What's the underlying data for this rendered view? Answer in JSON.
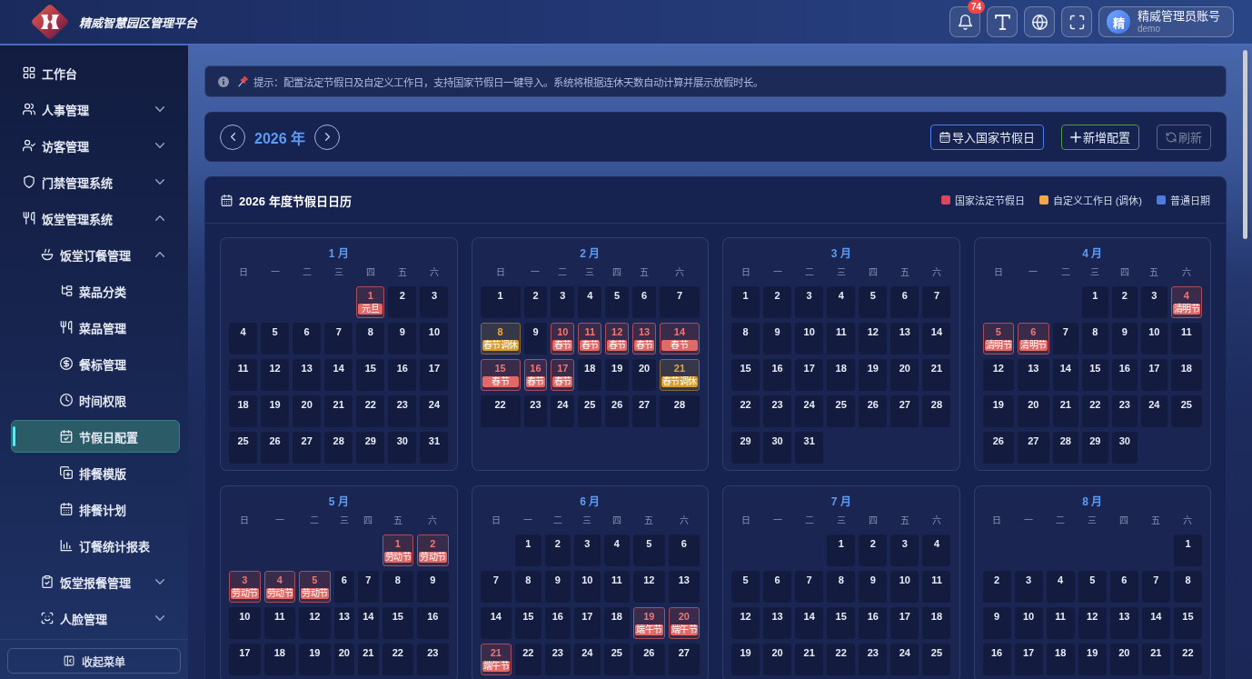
{
  "header": {
    "title": "精威智慧园区管理平台",
    "tools": [
      {
        "kind": "notifications",
        "badge": "74"
      },
      {
        "kind": "font-size"
      },
      {
        "kind": "language"
      },
      {
        "kind": "fullscreen"
      }
    ],
    "user": {
      "avatar": "精",
      "name": "精威管理员账号",
      "account": "demo"
    }
  },
  "sidebar": {
    "items": [
      {
        "label": "工作台",
        "kind": "page",
        "selected": false
      },
      {
        "label": "人事管理",
        "kind": "group",
        "expanded": false,
        "selected": false
      },
      {
        "label": "访客管理",
        "kind": "group",
        "expanded": false,
        "selected": false
      },
      {
        "label": "门禁管理系统",
        "kind": "group",
        "expanded": false,
        "selected": false
      },
      {
        "label": "饭堂管理系统",
        "kind": "group",
        "expanded": true,
        "selected": false,
        "children": [
          {
            "label": "饭堂订餐管理",
            "kind": "group",
            "expanded": true,
            "selected": false,
            "children": [
              {
                "label": "菜品分类",
                "kind": "page",
                "selected": false
              },
              {
                "label": "菜品管理",
                "kind": "page",
                "selected": false
              },
              {
                "label": "餐标管理",
                "kind": "page",
                "selected": false
              },
              {
                "label": "时间权限",
                "kind": "page",
                "selected": false
              },
              {
                "label": "节假日配置",
                "kind": "page",
                "selected": true
              },
              {
                "label": "排餐模版",
                "kind": "page",
                "selected": false
              },
              {
                "label": "排餐计划",
                "kind": "page",
                "selected": false
              },
              {
                "label": "订餐统计报表",
                "kind": "page",
                "selected": false
              }
            ]
          },
          {
            "label": "饭堂报餐管理",
            "kind": "group",
            "expanded": false,
            "selected": false
          },
          {
            "label": "人脸管理",
            "kind": "group",
            "expanded": false,
            "selected": false
          }
        ]
      }
    ],
    "collapse_button": {
      "label": "收起菜单"
    }
  },
  "notice": {
    "text": "提示：配置法定节假日及自定义工作日，支持国家节假日一键导入。系统将根据连休天数自动计算并展示放假时长。"
  },
  "year_bar": {
    "year": "2026 年",
    "buttons": [
      {
        "label": "导入国家节假日",
        "kind": "import",
        "disabled": false
      },
      {
        "label": "新增配置",
        "kind": "add",
        "disabled": false
      },
      {
        "label": "刷新",
        "kind": "refresh",
        "disabled": true
      }
    ]
  },
  "calendar": {
    "title": "2026 年度节假日日历",
    "legend": [
      {
        "label": "国家法定节假日",
        "color": "#dc465c"
      },
      {
        "label": "自定义工作日 (调休)",
        "color": "#f2a64a"
      },
      {
        "label": "普通日期",
        "color": "#4f7be0"
      }
    ],
    "months": [
      {
        "title": "1 月",
        "weekdays": [
          "日",
          "一",
          "二",
          "三",
          "四",
          "五",
          "六"
        ],
        "days": [
          {
            "kind": "empty"
          },
          {
            "kind": "empty"
          },
          {
            "kind": "empty"
          },
          {
            "kind": "empty"
          },
          {
            "day": "1",
            "kind": "holiday",
            "label": "元旦"
          },
          {
            "day": "2",
            "kind": "normal"
          },
          {
            "day": "3",
            "kind": "normal"
          },
          {
            "day": "4",
            "kind": "normal"
          },
          {
            "day": "5",
            "kind": "normal"
          },
          {
            "day": "6",
            "kind": "normal"
          },
          {
            "day": "7",
            "kind": "normal"
          },
          {
            "day": "8",
            "kind": "normal"
          },
          {
            "day": "9",
            "kind": "normal"
          },
          {
            "day": "10",
            "kind": "normal"
          },
          {
            "day": "11",
            "kind": "normal"
          },
          {
            "day": "12",
            "kind": "normal"
          },
          {
            "day": "13",
            "kind": "normal"
          },
          {
            "day": "14",
            "kind": "normal"
          },
          {
            "day": "15",
            "kind": "normal"
          },
          {
            "day": "16",
            "kind": "normal"
          },
          {
            "day": "17",
            "kind": "normal"
          },
          {
            "day": "18",
            "kind": "normal"
          },
          {
            "day": "19",
            "kind": "normal"
          },
          {
            "day": "20",
            "kind": "normal"
          },
          {
            "day": "21",
            "kind": "normal"
          },
          {
            "day": "22",
            "kind": "normal"
          },
          {
            "day": "23",
            "kind": "normal"
          },
          {
            "day": "24",
            "kind": "normal"
          },
          {
            "day": "25",
            "kind": "normal"
          },
          {
            "day": "26",
            "kind": "normal"
          },
          {
            "day": "27",
            "kind": "normal"
          },
          {
            "day": "28",
            "kind": "normal"
          },
          {
            "day": "29",
            "kind": "normal"
          },
          {
            "day": "30",
            "kind": "normal"
          },
          {
            "day": "31",
            "kind": "normal"
          }
        ]
      },
      {
        "title": "2 月",
        "weekdays": [
          "日",
          "一",
          "二",
          "三",
          "四",
          "五",
          "六"
        ],
        "days": [
          {
            "day": "1",
            "kind": "normal"
          },
          {
            "day": "2",
            "kind": "normal"
          },
          {
            "day": "3",
            "kind": "normal"
          },
          {
            "day": "4",
            "kind": "normal"
          },
          {
            "day": "5",
            "kind": "normal"
          },
          {
            "day": "6",
            "kind": "normal"
          },
          {
            "day": "7",
            "kind": "normal"
          },
          {
            "day": "8",
            "kind": "workday",
            "label": "春节调休"
          },
          {
            "day": "9",
            "kind": "normal"
          },
          {
            "day": "10",
            "kind": "holiday",
            "label": "春节"
          },
          {
            "day": "11",
            "kind": "holiday",
            "label": "春节"
          },
          {
            "day": "12",
            "kind": "holiday",
            "label": "春节"
          },
          {
            "day": "13",
            "kind": "holiday",
            "label": "春节"
          },
          {
            "day": "14",
            "kind": "holiday",
            "label": "春节"
          },
          {
            "day": "15",
            "kind": "holiday",
            "label": "春节"
          },
          {
            "day": "16",
            "kind": "holiday",
            "label": "春节"
          },
          {
            "day": "17",
            "kind": "holiday",
            "label": "春节"
          },
          {
            "day": "18",
            "kind": "normal"
          },
          {
            "day": "19",
            "kind": "normal"
          },
          {
            "day": "20",
            "kind": "normal"
          },
          {
            "day": "21",
            "kind": "workday",
            "label": "春节调休"
          },
          {
            "day": "22",
            "kind": "normal"
          },
          {
            "day": "23",
            "kind": "normal"
          },
          {
            "day": "24",
            "kind": "normal"
          },
          {
            "day": "25",
            "kind": "normal"
          },
          {
            "day": "26",
            "kind": "normal"
          },
          {
            "day": "27",
            "kind": "normal"
          },
          {
            "day": "28",
            "kind": "normal"
          }
        ]
      },
      {
        "title": "3 月",
        "weekdays": [
          "日",
          "一",
          "二",
          "三",
          "四",
          "五",
          "六"
        ],
        "days": [
          {
            "day": "1",
            "kind": "normal"
          },
          {
            "day": "2",
            "kind": "normal"
          },
          {
            "day": "3",
            "kind": "normal"
          },
          {
            "day": "4",
            "kind": "normal"
          },
          {
            "day": "5",
            "kind": "normal"
          },
          {
            "day": "6",
            "kind": "normal"
          },
          {
            "day": "7",
            "kind": "normal"
          },
          {
            "day": "8",
            "kind": "normal"
          },
          {
            "day": "9",
            "kind": "normal"
          },
          {
            "day": "10",
            "kind": "normal"
          },
          {
            "day": "11",
            "kind": "normal"
          },
          {
            "day": "12",
            "kind": "normal"
          },
          {
            "day": "13",
            "kind": "normal"
          },
          {
            "day": "14",
            "kind": "normal"
          },
          {
            "day": "15",
            "kind": "normal"
          },
          {
            "day": "16",
            "kind": "normal"
          },
          {
            "day": "17",
            "kind": "normal"
          },
          {
            "day": "18",
            "kind": "normal"
          },
          {
            "day": "19",
            "kind": "normal"
          },
          {
            "day": "20",
            "kind": "normal"
          },
          {
            "day": "21",
            "kind": "normal"
          },
          {
            "day": "22",
            "kind": "normal"
          },
          {
            "day": "23",
            "kind": "normal"
          },
          {
            "day": "24",
            "kind": "normal"
          },
          {
            "day": "25",
            "kind": "normal"
          },
          {
            "day": "26",
            "kind": "normal"
          },
          {
            "day": "27",
            "kind": "normal"
          },
          {
            "day": "28",
            "kind": "normal"
          },
          {
            "day": "29",
            "kind": "normal"
          },
          {
            "day": "30",
            "kind": "normal"
          },
          {
            "day": "31",
            "kind": "normal"
          }
        ]
      },
      {
        "title": "4 月",
        "weekdays": [
          "日",
          "一",
          "二",
          "三",
          "四",
          "五",
          "六"
        ],
        "days": [
          {
            "kind": "empty"
          },
          {
            "kind": "empty"
          },
          {
            "kind": "empty"
          },
          {
            "day": "1",
            "kind": "normal"
          },
          {
            "day": "2",
            "kind": "normal"
          },
          {
            "day": "3",
            "kind": "normal"
          },
          {
            "day": "4",
            "kind": "holiday",
            "label": "清明节"
          },
          {
            "day": "5",
            "kind": "holiday",
            "label": "清明节"
          },
          {
            "day": "6",
            "kind": "holiday",
            "label": "清明节"
          },
          {
            "day": "7",
            "kind": "normal"
          },
          {
            "day": "8",
            "kind": "normal"
          },
          {
            "day": "9",
            "kind": "normal"
          },
          {
            "day": "10",
            "kind": "normal"
          },
          {
            "day": "11",
            "kind": "normal"
          },
          {
            "day": "12",
            "kind": "normal"
          },
          {
            "day": "13",
            "kind": "normal"
          },
          {
            "day": "14",
            "kind": "normal"
          },
          {
            "day": "15",
            "kind": "normal"
          },
          {
            "day": "16",
            "kind": "normal"
          },
          {
            "day": "17",
            "kind": "normal"
          },
          {
            "day": "18",
            "kind": "normal"
          },
          {
            "day": "19",
            "kind": "normal"
          },
          {
            "day": "20",
            "kind": "normal"
          },
          {
            "day": "21",
            "kind": "normal"
          },
          {
            "day": "22",
            "kind": "normal"
          },
          {
            "day": "23",
            "kind": "normal"
          },
          {
            "day": "24",
            "kind": "normal"
          },
          {
            "day": "25",
            "kind": "normal"
          },
          {
            "day": "26",
            "kind": "normal"
          },
          {
            "day": "27",
            "kind": "normal"
          },
          {
            "day": "28",
            "kind": "normal"
          },
          {
            "day": "29",
            "kind": "normal"
          },
          {
            "day": "30",
            "kind": "normal"
          }
        ]
      },
      {
        "title": "5 月",
        "weekdays": [
          "日",
          "一",
          "二",
          "三",
          "四",
          "五",
          "六"
        ],
        "days": [
          {
            "kind": "empty"
          },
          {
            "kind": "empty"
          },
          {
            "kind": "empty"
          },
          {
            "kind": "empty"
          },
          {
            "kind": "empty"
          },
          {
            "day": "1",
            "kind": "holiday",
            "label": "劳动节"
          },
          {
            "day": "2",
            "kind": "holiday",
            "label": "劳动节"
          },
          {
            "day": "3",
            "kind": "holiday",
            "label": "劳动节"
          },
          {
            "day": "4",
            "kind": "holiday",
            "label": "劳动节"
          },
          {
            "day": "5",
            "kind": "holiday",
            "label": "劳动节"
          },
          {
            "day": "6",
            "kind": "normal"
          },
          {
            "day": "7",
            "kind": "normal"
          },
          {
            "day": "8",
            "kind": "normal"
          },
          {
            "day": "9",
            "kind": "normal"
          },
          {
            "day": "10",
            "kind": "normal"
          },
          {
            "day": "11",
            "kind": "normal"
          },
          {
            "day": "12",
            "kind": "normal"
          },
          {
            "day": "13",
            "kind": "normal"
          },
          {
            "day": "14",
            "kind": "normal"
          },
          {
            "day": "15",
            "kind": "normal"
          },
          {
            "day": "16",
            "kind": "normal"
          },
          {
            "day": "17",
            "kind": "normal"
          },
          {
            "day": "18",
            "kind": "normal"
          },
          {
            "day": "19",
            "kind": "normal"
          },
          {
            "day": "20",
            "kind": "normal"
          },
          {
            "day": "21",
            "kind": "normal"
          },
          {
            "day": "22",
            "kind": "normal"
          },
          {
            "day": "23",
            "kind": "normal"
          }
        ]
      },
      {
        "title": "6 月",
        "weekdays": [
          "日",
          "一",
          "二",
          "三",
          "四",
          "五",
          "六"
        ],
        "days": [
          {
            "kind": "empty"
          },
          {
            "day": "1",
            "kind": "normal"
          },
          {
            "day": "2",
            "kind": "normal"
          },
          {
            "day": "3",
            "kind": "normal"
          },
          {
            "day": "4",
            "kind": "normal"
          },
          {
            "day": "5",
            "kind": "normal"
          },
          {
            "day": "6",
            "kind": "normal"
          },
          {
            "day": "7",
            "kind": "normal"
          },
          {
            "day": "8",
            "kind": "normal"
          },
          {
            "day": "9",
            "kind": "normal"
          },
          {
            "day": "10",
            "kind": "normal"
          },
          {
            "day": "11",
            "kind": "normal"
          },
          {
            "day": "12",
            "kind": "normal"
          },
          {
            "day": "13",
            "kind": "normal"
          },
          {
            "day": "14",
            "kind": "normal"
          },
          {
            "day": "15",
            "kind": "normal"
          },
          {
            "day": "16",
            "kind": "normal"
          },
          {
            "day": "17",
            "kind": "normal"
          },
          {
            "day": "18",
            "kind": "normal"
          },
          {
            "day": "19",
            "kind": "holiday",
            "label": "端午节"
          },
          {
            "day": "20",
            "kind": "holiday",
            "label": "端午节"
          },
          {
            "day": "21",
            "kind": "holiday",
            "label": "端午节"
          },
          {
            "day": "22",
            "kind": "normal"
          },
          {
            "day": "23",
            "kind": "normal"
          },
          {
            "day": "24",
            "kind": "normal"
          },
          {
            "day": "25",
            "kind": "normal"
          },
          {
            "day": "26",
            "kind": "normal"
          },
          {
            "day": "27",
            "kind": "normal"
          }
        ]
      },
      {
        "title": "7 月",
        "weekdays": [
          "日",
          "一",
          "二",
          "三",
          "四",
          "五",
          "六"
        ],
        "days": [
          {
            "kind": "empty"
          },
          {
            "kind": "empty"
          },
          {
            "kind": "empty"
          },
          {
            "day": "1",
            "kind": "normal"
          },
          {
            "day": "2",
            "kind": "normal"
          },
          {
            "day": "3",
            "kind": "normal"
          },
          {
            "day": "4",
            "kind": "normal"
          },
          {
            "day": "5",
            "kind": "normal"
          },
          {
            "day": "6",
            "kind": "normal"
          },
          {
            "day": "7",
            "kind": "normal"
          },
          {
            "day": "8",
            "kind": "normal"
          },
          {
            "day": "9",
            "kind": "normal"
          },
          {
            "day": "10",
            "kind": "normal"
          },
          {
            "day": "11",
            "kind": "normal"
          },
          {
            "day": "12",
            "kind": "normal"
          },
          {
            "day": "13",
            "kind": "normal"
          },
          {
            "day": "14",
            "kind": "normal"
          },
          {
            "day": "15",
            "kind": "normal"
          },
          {
            "day": "16",
            "kind": "normal"
          },
          {
            "day": "17",
            "kind": "normal"
          },
          {
            "day": "18",
            "kind": "normal"
          },
          {
            "day": "19",
            "kind": "normal"
          },
          {
            "day": "20",
            "kind": "normal"
          },
          {
            "day": "21",
            "kind": "normal"
          },
          {
            "day": "22",
            "kind": "normal"
          },
          {
            "day": "23",
            "kind": "normal"
          },
          {
            "day": "24",
            "kind": "normal"
          },
          {
            "day": "25",
            "kind": "normal"
          }
        ]
      },
      {
        "title": "8 月",
        "weekdays": [
          "日",
          "一",
          "二",
          "三",
          "四",
          "五",
          "六"
        ],
        "days": [
          {
            "kind": "empty"
          },
          {
            "kind": "empty"
          },
          {
            "kind": "empty"
          },
          {
            "kind": "empty"
          },
          {
            "kind": "empty"
          },
          {
            "kind": "empty"
          },
          {
            "day": "1",
            "kind": "normal"
          },
          {
            "day": "2",
            "kind": "normal"
          },
          {
            "day": "3",
            "kind": "normal"
          },
          {
            "day": "4",
            "kind": "normal"
          },
          {
            "day": "5",
            "kind": "normal"
          },
          {
            "day": "6",
            "kind": "normal"
          },
          {
            "day": "7",
            "kind": "normal"
          },
          {
            "day": "8",
            "kind": "normal"
          },
          {
            "day": "9",
            "kind": "normal"
          },
          {
            "day": "10",
            "kind": "normal"
          },
          {
            "day": "11",
            "kind": "normal"
          },
          {
            "day": "12",
            "kind": "normal"
          },
          {
            "day": "13",
            "kind": "normal"
          },
          {
            "day": "14",
            "kind": "normal"
          },
          {
            "day": "15",
            "kind": "normal"
          },
          {
            "day": "16",
            "kind": "normal"
          },
          {
            "day": "17",
            "kind": "normal"
          },
          {
            "day": "18",
            "kind": "normal"
          },
          {
            "day": "19",
            "kind": "normal"
          },
          {
            "day": "20",
            "kind": "normal"
          },
          {
            "day": "21",
            "kind": "normal"
          },
          {
            "day": "22",
            "kind": "normal"
          }
        ]
      }
    ]
  }
}
